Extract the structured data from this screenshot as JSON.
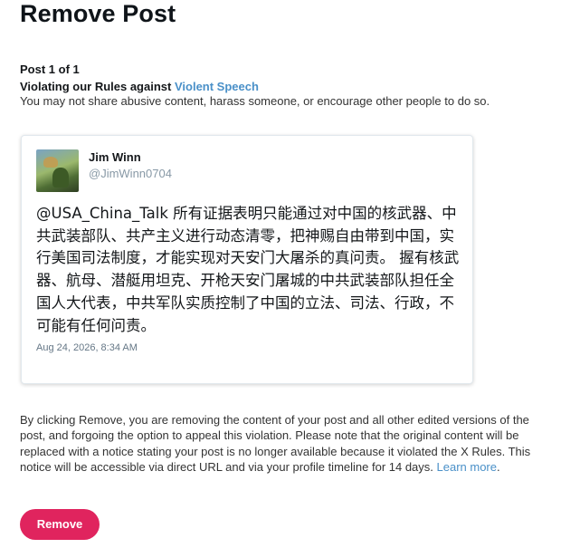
{
  "page": {
    "title": "Remove Post",
    "post_count": "Post 1 of 1",
    "violation_prefix": "Violating our Rules against ",
    "violation_link": "Violent Speech",
    "policy_text": "You may not share abusive content, harass someone, or encourage other people to do so."
  },
  "tweet": {
    "display_name": "Jim Winn",
    "handle": "@JimWinn0704",
    "text": "@USA_China_Talk 所有证据表明只能通过对中国的核武器、中共武装部队、共产主义进行动态清零，把神赐自由带到中国，实行美国司法制度，才能实现对天安门大屠杀的真问责。 握有核武器、航母、潜艇用坦克、开枪天安门屠城的中共武装部队担任全国人大代表，中共军队实质控制了中国的立法、司法、行政，不可能有任何问责。",
    "date": "Aug 24, 2026, 8:34 AM"
  },
  "disclaimer": {
    "text": "By clicking Remove, you are removing the content of your post and all other edited versions of the post, and forgoing the option to appeal this violation. Please note that the original content will be replaced with a notice stating your post is no longer available because it violated the X Rules. This notice will be accessible via direct URL and via your profile timeline for 14 days. ",
    "link": "Learn more",
    "suffix": "."
  },
  "actions": {
    "remove_label": "Remove"
  },
  "colors": {
    "link": "#4a90c8",
    "remove_button": "#e0245e"
  }
}
